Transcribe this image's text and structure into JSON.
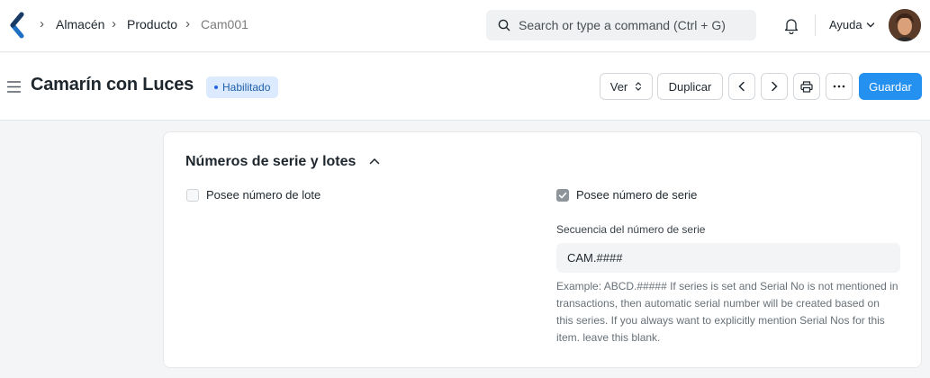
{
  "navbar": {
    "breadcrumbs": [
      "Almacén",
      "Producto",
      "Cam001"
    ],
    "search_placeholder": "Search or type a command (Ctrl + G)",
    "help_label": "Ayuda",
    "icons": [
      "app-logo-icon",
      "search-icon",
      "bell-icon",
      "chevron-down-icon",
      "avatar"
    ]
  },
  "header": {
    "title": "Camarín con Luces",
    "status": "Habilitado",
    "buttons": {
      "view": "Ver",
      "duplicate": "Duplicar",
      "save": "Guardar"
    },
    "icons": [
      "hamburger-icon",
      "prev-icon",
      "next-icon",
      "print-icon",
      "more-icon"
    ]
  },
  "section": {
    "title": "Números de serie y lotes",
    "has_batch_no": {
      "label": "Posee número de lote",
      "checked": false
    },
    "has_serial_no": {
      "label": "Posee número de serie",
      "checked": true
    },
    "serial_series": {
      "label": "Secuencia del número de serie",
      "value": "CAM.####",
      "help": "Example: ABCD.##### If series is set and Serial No is not mentioned in transactions, then automatic serial number will be created based on this series. If you always want to explicitly mention Serial Nos for this item. leave this blank."
    }
  },
  "colors": {
    "primary": "#2490ef",
    "badge_bg": "#dbeafe",
    "badge_text": "#1f5fa8",
    "background": "#f4f5f6"
  }
}
